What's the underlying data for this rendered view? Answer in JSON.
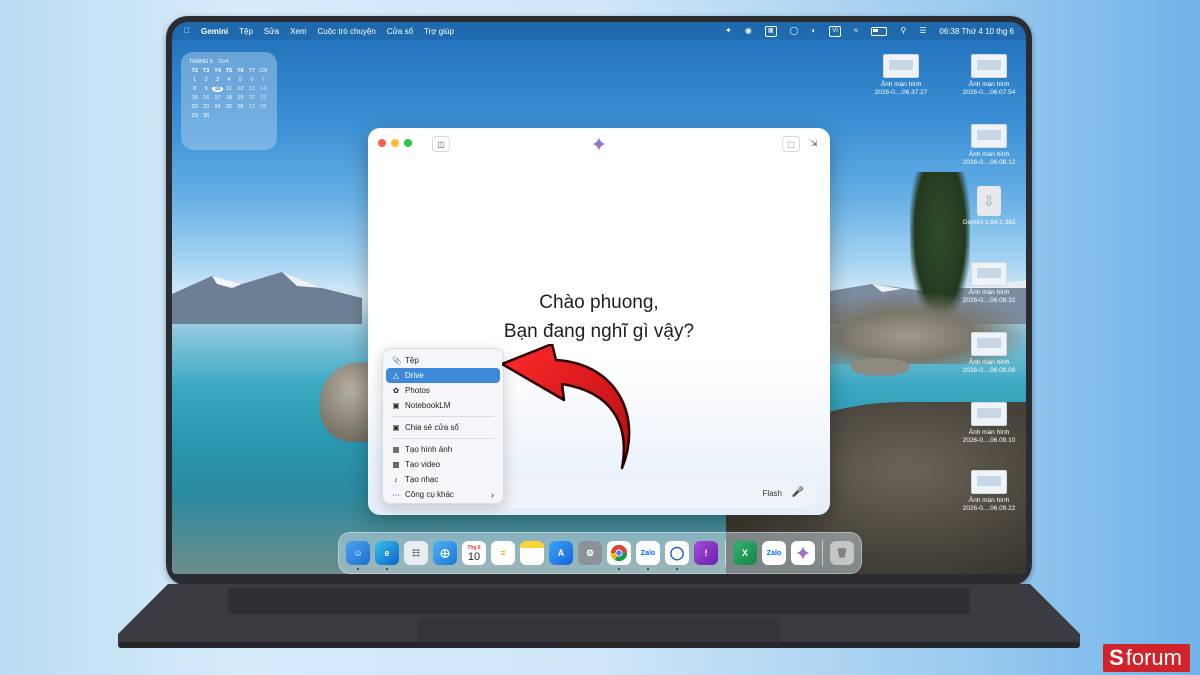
{
  "menubar": {
    "app_name": "Gemini",
    "menus": [
      "Tệp",
      "Sửa",
      "Xem",
      "Cuộc trò chuyện",
      "Cửa sổ",
      "Trợ giúp"
    ],
    "input_language": "VI",
    "datetime": "06:38 Thứ 4 10 thg 6"
  },
  "calendar": {
    "month": "THÁNG 6",
    "lunar": "25/4",
    "weekdays": [
      "T2",
      "T3",
      "T4",
      "T5",
      "T6",
      "T7",
      "CN"
    ],
    "rows": [
      [
        "1",
        "2",
        "3",
        "4",
        "5",
        "6",
        "7"
      ],
      [
        "8",
        "9",
        "10",
        "11",
        "12",
        "13",
        "14"
      ],
      [
        "15",
        "16",
        "17",
        "18",
        "19",
        "20",
        "21"
      ],
      [
        "22",
        "23",
        "24",
        "25",
        "26",
        "27",
        "28"
      ],
      [
        "29",
        "30",
        "",
        "",
        "",
        "",
        ""
      ]
    ],
    "today": "10"
  },
  "desktop_icons": [
    {
      "title": "Ảnh màn hình",
      "subtitle": "2026-0....06.37.27"
    },
    {
      "title": "Ảnh màn hình",
      "subtitle": "2026-0....06.07.54"
    },
    {
      "title": "Ảnh màn hình",
      "subtitle": "2026-0....06.08.12"
    },
    {
      "title": "Gemini 1.64.1.362",
      "subtitle": ""
    },
    {
      "title": "Ảnh màn hình",
      "subtitle": "2026-0....06.08.32"
    },
    {
      "title": "Ảnh màn hình",
      "subtitle": "2026-0....06.09.00"
    },
    {
      "title": "Ảnh màn hình",
      "subtitle": "2026-0....06.09.10"
    },
    {
      "title": "Ảnh màn hình",
      "subtitle": "2026-0....06.09.22"
    }
  ],
  "gemini": {
    "greeting_line1": "Chào phuong,",
    "greeting_line2": "Bạn đang nghĩ gì vậy?",
    "model_label": "Flash"
  },
  "attach_menu": {
    "items": [
      {
        "label": "Tệp",
        "icon": "paperclip-icon"
      },
      {
        "label": "Drive",
        "icon": "drive-icon"
      },
      {
        "label": "Photos",
        "icon": "photos-icon"
      },
      {
        "label": "NotebookLM",
        "icon": "notebook-icon"
      },
      {
        "label": "Chia sẻ cửa sổ",
        "icon": "share-window-icon"
      },
      {
        "label": "Tạo hình ảnh",
        "icon": "image-icon"
      },
      {
        "label": "Tạo video",
        "icon": "video-icon"
      },
      {
        "label": "Tạo nhạc",
        "icon": "music-icon"
      },
      {
        "label": "Công cụ khác",
        "icon": "more-icon"
      }
    ],
    "selected": "Drive"
  },
  "dock": {
    "calendar_month": "Thg 6",
    "calendar_day": "10",
    "zalo_label": "Zalo"
  },
  "brand": {
    "logo_text": "forum",
    "color": "#d0232a"
  },
  "colors": {
    "accent": "#3f8ad8",
    "arrow": "#e0161d"
  }
}
